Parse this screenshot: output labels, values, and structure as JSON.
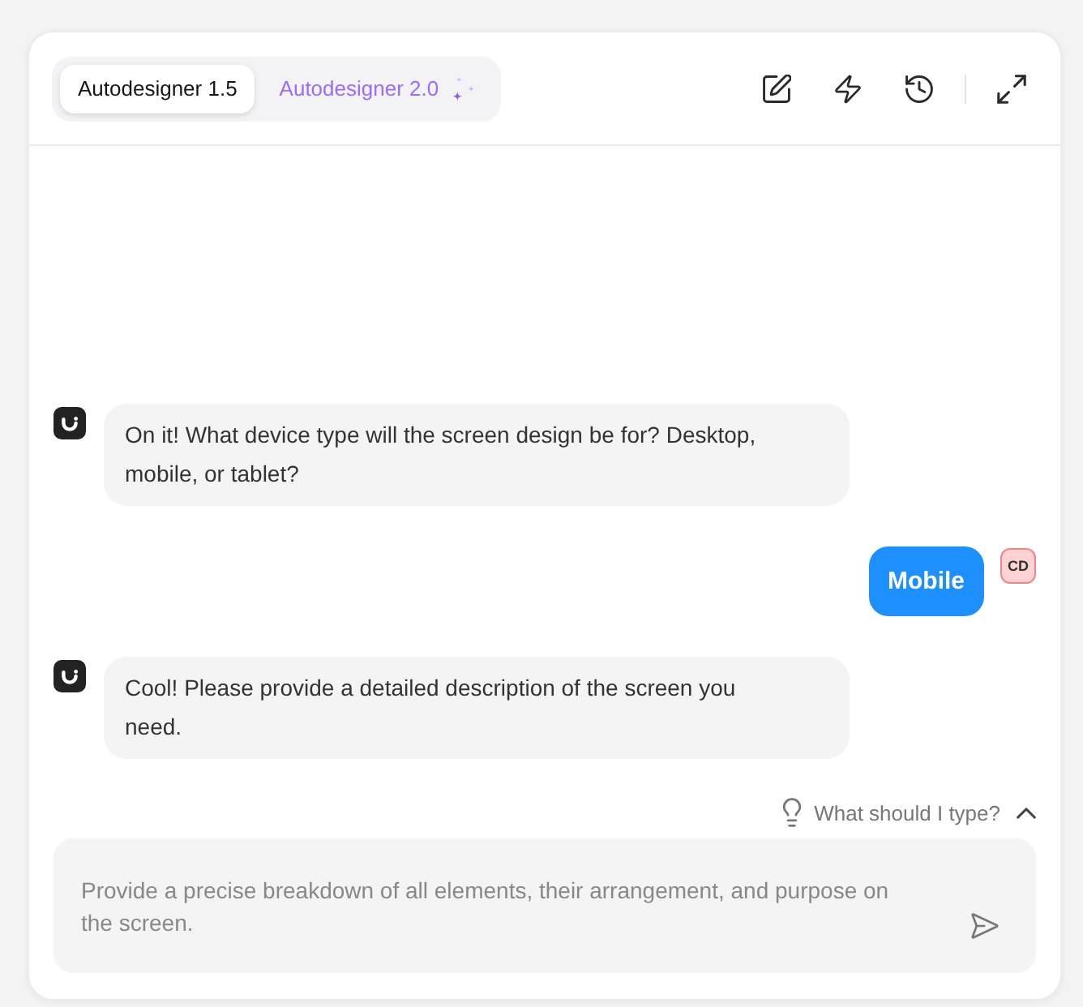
{
  "header": {
    "tabs": [
      {
        "label": "Autodesigner 1.5",
        "selected": true,
        "kind": "plain"
      },
      {
        "label": "Autodesigner 2.0",
        "selected": false,
        "kind": "sparkle"
      }
    ]
  },
  "messages": [
    {
      "kind": "bot",
      "text": "On it! What device type will the screen design be for? Desktop, mobile, or tablet?"
    },
    {
      "kind": "user",
      "text": "Mobile",
      "avatar": "CD"
    },
    {
      "kind": "bot",
      "text": "Cool! Please provide a detailed description of the screen you need."
    }
  ],
  "hint": {
    "label": "What should I type?"
  },
  "composer": {
    "placeholder": "Provide a precise breakdown of all elements, their arrangement, and purpose on the screen."
  }
}
